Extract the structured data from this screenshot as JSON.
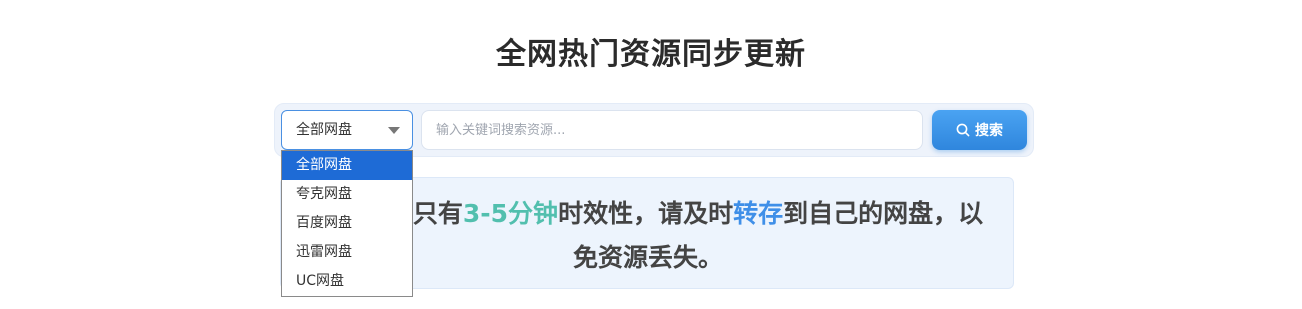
{
  "header": {
    "title": "全网热门资源同步更新"
  },
  "search": {
    "disk_select": {
      "selected": "全部网盘",
      "options": [
        "全部网盘",
        "夸克网盘",
        "百度网盘",
        "迅雷网盘",
        "UC网盘"
      ],
      "expanded": true
    },
    "placeholder": "输入关键词搜索资源...",
    "value": "",
    "button_label": "搜索",
    "button_icon": "search-icon"
  },
  "notice": {
    "parts": [
      "搜索结果只有",
      "3-5分钟",
      "时效性，请及时",
      "转存",
      "到自己的网盘，以免资源丢失。"
    ]
  },
  "colors": {
    "accent": "#2f86dd",
    "highlight_teal": "#52bfae",
    "highlight_blue": "#3f8fe8",
    "selected_option": "#1e6bd6"
  }
}
